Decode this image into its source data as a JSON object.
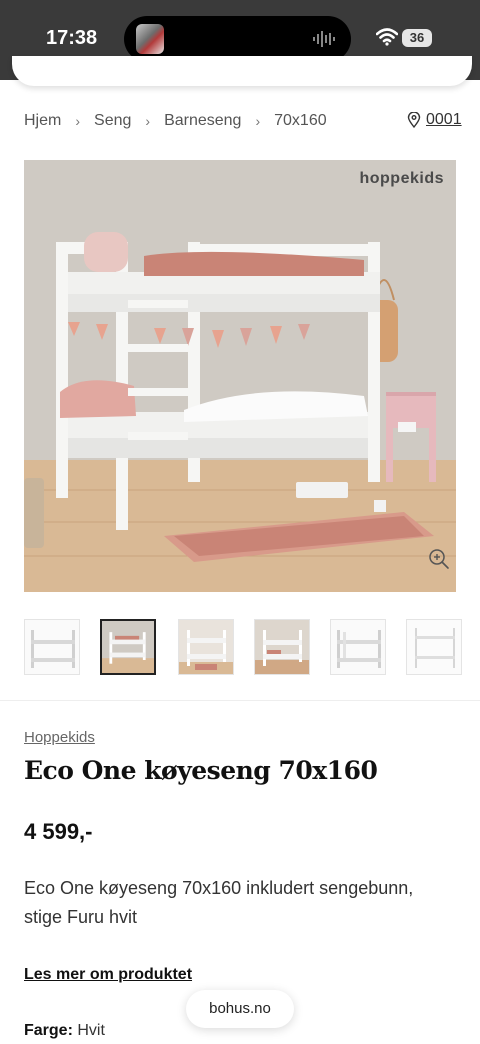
{
  "status_bar": {
    "time": "17:38",
    "battery": "36",
    "wifi_icon": "wifi-icon",
    "activity_icon": "waveform-icon"
  },
  "breadcrumb": {
    "items": [
      "Hjem",
      "Seng",
      "Barneseng",
      "70x160"
    ],
    "separator_icon": "chevron-right-icon"
  },
  "store": {
    "icon": "map-pin-icon",
    "label": "0001"
  },
  "gallery": {
    "brand_watermark": "hoppekids",
    "zoom_icon": "zoom-in-icon",
    "thumbnail_count": 6,
    "active_thumbnail": 1
  },
  "product": {
    "brand": "Hoppekids",
    "title": "Eco One køyeseng 70x160",
    "price": "4 599,-",
    "description": "Eco One køyeseng 70x160 inkludert sengebunn, stige Furu hvit",
    "read_more": "Les mer om produktet",
    "color_label": "Farge:",
    "color_value": "Hvit"
  },
  "browser": {
    "url": "bohus.no"
  },
  "colors": {
    "status_bar": "#3a3a3a",
    "wall": "#cfcac3",
    "floor": "#d9b995",
    "bed": "#f5f5f3",
    "accent_pink": "#d9a39a"
  }
}
